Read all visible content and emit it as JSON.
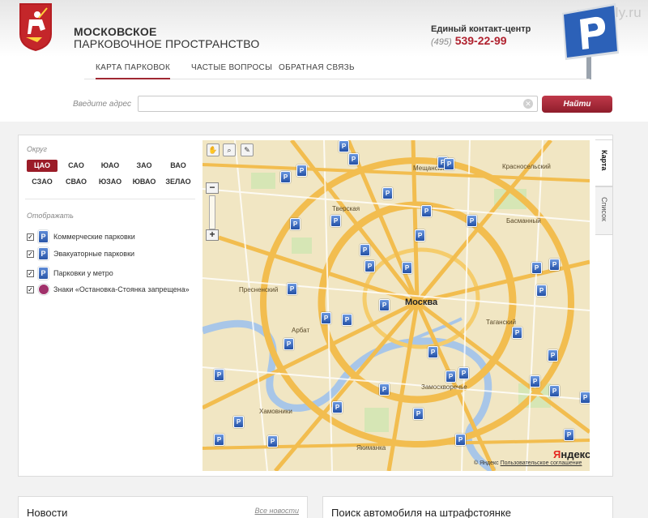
{
  "watermark": "vmdaily.ru",
  "brand": {
    "line1": "МОСКОВСКОЕ",
    "line2": "ПАРКОВОЧНОЕ ПРОСТРАНСТВО"
  },
  "contact": {
    "label": "Единый контакт-центр",
    "code": "(495)",
    "number": "539-22-99"
  },
  "nav": {
    "tabs": [
      {
        "label": "КАРТА ПАРКОВОК",
        "active": true
      },
      {
        "label": "ЧАСТЫЕ ВОПРОСЫ",
        "active": false
      },
      {
        "label": "ОБРАТНАЯ СВЯЗЬ",
        "active": false
      }
    ]
  },
  "search": {
    "label": "Введите адрес",
    "value": "",
    "button": "Найти"
  },
  "sidebar": {
    "district_title": "Округ",
    "districts": [
      "ЦАО",
      "САО",
      "ЮАО",
      "ЗАО",
      "ВАО",
      "СЗАО",
      "СВАО",
      "ЮЗАО",
      "ЮВАО",
      "ЗЕЛАО"
    ],
    "active_district": "ЦАО",
    "show_title": "Отображать",
    "layers": [
      {
        "label": "Коммерческие парковки",
        "checked": true,
        "icon": "parking-commercial-icon"
      },
      {
        "label": "Эвакуаторные парковки",
        "checked": true,
        "icon": "parking-tow-icon"
      },
      {
        "label": "Парковки у метро",
        "checked": true,
        "icon": "parking-metro-icon"
      },
      {
        "label": "Знаки «Остановка-Стоянка запрещена»",
        "checked": true,
        "icon": "no-stopping-sign-icon"
      }
    ]
  },
  "map": {
    "labels": [
      "Тверская",
      "Пресненский",
      "Хамовники",
      "Арбат",
      "Якиманка",
      "Таганский",
      "Басманный",
      "Красносельский",
      "Мещанский",
      "Замоскворечье"
    ],
    "city": "Москва",
    "provider_y": "Я",
    "provider": "ндекс",
    "copyright": "© Яндекс",
    "terms": "Пользовательское соглашение",
    "tabs": [
      "Карта",
      "Список"
    ],
    "active_tab": "Карта"
  },
  "news": {
    "title": "Новости",
    "all": "Все новости"
  },
  "impound": {
    "title": "Поиск автомобиля на штрафстоянке"
  },
  "colors": {
    "accent": "#9b1c28",
    "parking_blue": "#2f5fb3",
    "phone": "#b0222f"
  }
}
